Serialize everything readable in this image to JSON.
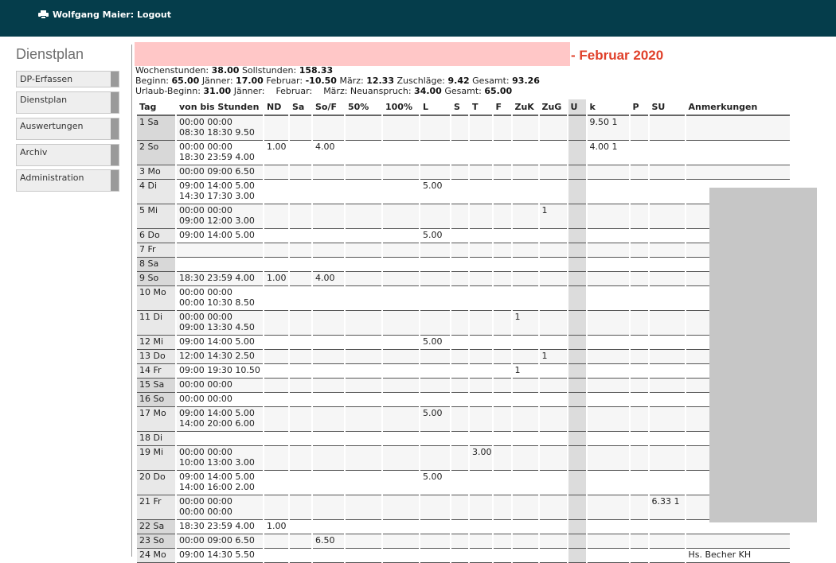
{
  "header": {
    "user_label": "Wolfgang Maier: Logout"
  },
  "sidebar": {
    "title": "Dienstplan",
    "items": [
      "DP-Erfassen",
      "Dienstplan",
      "Auswertungen",
      "Archiv",
      "Administration"
    ]
  },
  "title": {
    "month": "- Februar 2020"
  },
  "summary": {
    "wochenstunden_label": "Wochenstunden:",
    "wochenstunden": "38.00",
    "sollstunden_label": "Sollstunden:",
    "sollstunden": "158.33",
    "beginn_label": "Beginn:",
    "beginn": "65.00",
    "jaenner_label": "Jänner:",
    "jaenner": "17.00",
    "februar_label": "Februar:",
    "februar": "-10.50",
    "maerz_label": "März:",
    "maerz": "12.33",
    "zuschlaege_label": "Zuschläge:",
    "zuschlaege": "9.42",
    "gesamt_label": "Gesamt:",
    "gesamt": "93.26",
    "urlaub_beginn_label": "Urlaub-Beginn:",
    "urlaub_beginn": "31.00",
    "u_jaenner_label": "Jänner:",
    "u_februar_label": "Februar:",
    "u_maerz_label": "März:",
    "neuanspruch_label": "Neuanspruch:",
    "neuanspruch": "34.00",
    "u_gesamt_label": "Gesamt:",
    "u_gesamt": "65.00"
  },
  "table": {
    "columns": [
      "Tag",
      "von bis Stunden",
      "ND",
      "Sa",
      "So/F",
      "50%",
      "100%",
      "L",
      "S",
      "T",
      "F",
      "ZuK",
      "ZuG",
      "U",
      "k",
      "P",
      "SU",
      "Anmerkungen"
    ],
    "rows": [
      {
        "tag": "1 Sa",
        "we": true,
        "lines": [
          "00:00 00:00",
          "08:30 18:30 9.50"
        ],
        "k": "9.50  1"
      },
      {
        "tag": "2 So",
        "we": true,
        "lines": [
          "00:00 00:00",
          "18:30 23:59 4.00"
        ],
        "nd": "1.00",
        "sof": "4.00",
        "k": "4.00  1"
      },
      {
        "tag": "3 Mo",
        "lines": [
          "00:00 09:00 6.50"
        ]
      },
      {
        "tag": "4 Di",
        "lines": [
          "09:00 14:00 5.00",
          "14:30 17:30 3.00"
        ],
        "l": "5.00"
      },
      {
        "tag": "5 Mi",
        "lines": [
          "00:00 00:00",
          "09:00 12:00 3.00"
        ],
        "zug": "1"
      },
      {
        "tag": "6 Do",
        "lines": [
          "09:00 14:00 5.00"
        ],
        "l": "5.00"
      },
      {
        "tag": "7 Fr",
        "lines": [
          ""
        ]
      },
      {
        "tag": "8 Sa",
        "we": true,
        "lines": [
          ""
        ]
      },
      {
        "tag": "9 So",
        "we": true,
        "lines": [
          "18:30 23:59 4.00"
        ],
        "nd": "1.00",
        "sof": "4.00"
      },
      {
        "tag": "10 Mo",
        "lines": [
          "00:00 00:00",
          "00:00 10:30 8.50"
        ]
      },
      {
        "tag": "11 Di",
        "lines": [
          "00:00 00:00",
          "09:00 13:30 4.50"
        ],
        "zuk": "1"
      },
      {
        "tag": "12 Mi",
        "lines": [
          "09:00 14:00 5.00"
        ],
        "l": "5.00"
      },
      {
        "tag": "13 Do",
        "lines": [
          "12:00 14:30 2.50"
        ],
        "zug": "1"
      },
      {
        "tag": "14 Fr",
        "lines": [
          "09:00 19:30 10.50"
        ],
        "zuk": "1"
      },
      {
        "tag": "15 Sa",
        "we": true,
        "lines": [
          "00:00 00:00"
        ]
      },
      {
        "tag": "16 So",
        "we": true,
        "lines": [
          "00:00 00:00"
        ]
      },
      {
        "tag": "17 Mo",
        "lines": [
          "09:00 14:00 5.00",
          "14:00 20:00 6.00"
        ],
        "l": "5.00"
      },
      {
        "tag": "18 Di",
        "lines": [
          ""
        ]
      },
      {
        "tag": "19 Mi",
        "lines": [
          "00:00 00:00",
          "10:00 13:00 3.00"
        ],
        "t": "3.00"
      },
      {
        "tag": "20 Do",
        "lines": [
          "09:00 14:00 5.00",
          "14:00 16:00 2.00"
        ],
        "l": "5.00"
      },
      {
        "tag": "21 Fr",
        "lines": [
          "00:00 00:00",
          "00:00 00:00"
        ],
        "su": "6.33  1"
      },
      {
        "tag": "22 Sa",
        "we": true,
        "lines": [
          "18:30 23:59 4.00"
        ],
        "nd": "1.00"
      },
      {
        "tag": "23 So",
        "we": true,
        "lines": [
          "00:00 09:00 6.50"
        ],
        "sof": "6.50"
      },
      {
        "tag": "24 Mo",
        "lines": [
          "09:00 14:30 5.50"
        ],
        "anm": "Hs. Becher KH"
      }
    ]
  }
}
